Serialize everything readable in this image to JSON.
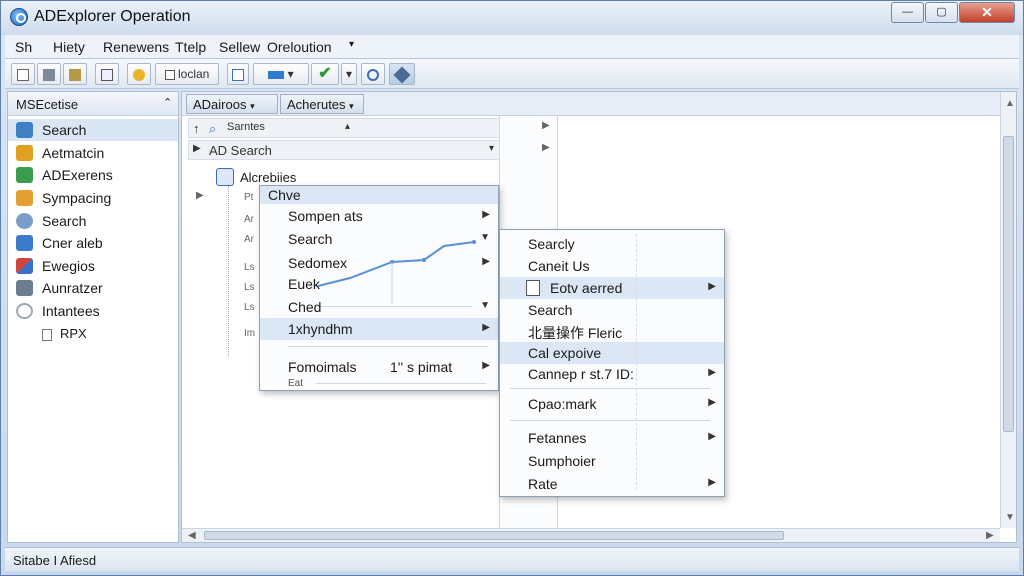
{
  "window": {
    "title": "ADExplorer Operation"
  },
  "titlebar": {
    "min": "—",
    "max": "▢",
    "close": "✕"
  },
  "menu": [
    "Sh",
    "Hiety",
    "Renewens",
    "Ttelp",
    "Sellew",
    "Oreloution"
  ],
  "menu_caret": "▾",
  "toolbar": {
    "location_label": "loclan",
    "caret": "▾",
    "check": "✔"
  },
  "sidebar": {
    "header": "MSEcetise",
    "collapse": "⌃",
    "items": [
      {
        "label": "Search",
        "icon": "search-tree-icon",
        "color": "#3f7fc4"
      },
      {
        "label": "Aetmatcin",
        "icon": "star-tools-icon",
        "color": "#e0a020"
      },
      {
        "label": "ADExerens",
        "icon": "table-icon",
        "color": "#3a9c4c"
      },
      {
        "label": "Sympacing",
        "icon": "folder-icon",
        "color": "#e4a032"
      },
      {
        "label": "Search",
        "icon": "disc-icon",
        "color": "#7a9ec8"
      },
      {
        "label": "Cner aleb",
        "icon": "pipe-icon",
        "color": "#3c7bc8"
      },
      {
        "label": "Ewegios",
        "icon": "pills-icon",
        "color": "#d0463c"
      },
      {
        "label": "Aunratzer",
        "icon": "tools-icon",
        "color": "#6b7c8f"
      },
      {
        "label": "Intantees",
        "icon": "clock-icon",
        "color": "#9aa7b7"
      }
    ],
    "sub_item": "RPX"
  },
  "tabs": [
    "ADairoos",
    "Acherutes"
  ],
  "tree": {
    "search_box": "Sarntes",
    "ad_search": "AD Search",
    "root": "Alcrebiies",
    "partial_labels": [
      "Pt",
      "Ar",
      "Ar",
      "Ls",
      "Ls",
      "Ls",
      "Im"
    ]
  },
  "menu1": {
    "header": "Chve",
    "items": [
      {
        "label": "Sompen ats",
        "arrow": "▶"
      },
      {
        "label": "Search",
        "arrow": "▼"
      },
      {
        "label": "Sedomex",
        "arrow": "▶"
      },
      {
        "label": "Euek",
        "arrow": ""
      },
      {
        "label": "Ched",
        "arrow": "▼"
      },
      {
        "label": "1xhyndhm",
        "arrow": "▶"
      },
      {
        "label": "Fomoimals",
        "arrow": "▶"
      }
    ],
    "footer_extra": "1'' s pimat",
    "footer_small": "Eat"
  },
  "menu2": {
    "items": [
      {
        "label": "Searcly",
        "arrow": ""
      },
      {
        "label": "Caneit Us",
        "arrow": ""
      },
      {
        "label": "Eotv aerred",
        "arrow": "▶"
      },
      {
        "label": "Search",
        "arrow": ""
      },
      {
        "label": "北量操作 Fleric",
        "arrow": ""
      },
      {
        "label": "Cal expoive",
        "arrow": ""
      },
      {
        "label": "Cannep r st.7 ID:",
        "arrow": "▶"
      },
      {
        "label": "Cpao:mark",
        "arrow": "▶"
      },
      {
        "label": "Fetannes",
        "arrow": "▶"
      },
      {
        "label": "Sumphoier",
        "arrow": ""
      },
      {
        "label": "Rate",
        "arrow": "▶"
      }
    ]
  },
  "status": "Sitabe I Afiesd",
  "colors": {
    "accent": "#dce7f5",
    "chart_line": "#5b8fd6"
  }
}
